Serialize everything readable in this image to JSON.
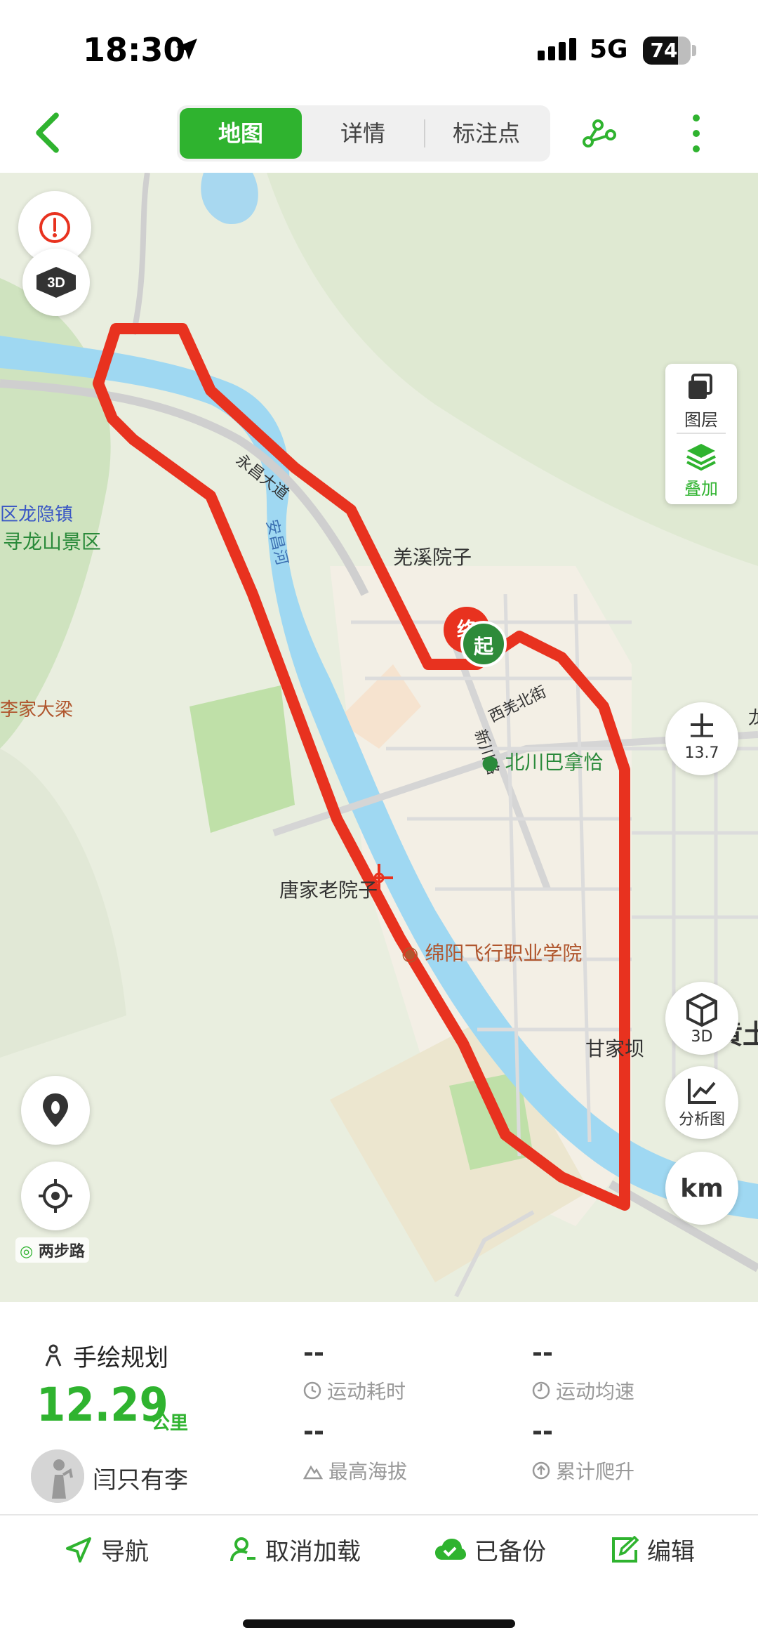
{
  "status": {
    "time": "18:30",
    "network": "5G",
    "battery": "74",
    "battery_level": 0.74
  },
  "header": {
    "tabs": [
      {
        "label": "地图",
        "active": true
      },
      {
        "label": "详情",
        "active": false
      },
      {
        "label": "标注点",
        "active": false
      }
    ],
    "accent_color": "#2fb32f"
  },
  "map": {
    "labels": {
      "town1": "区龙隐镇",
      "scenic": "寻龙山景区",
      "village1": "羌溪院子",
      "river": "安昌河",
      "road1": "永昌大道",
      "road2": "西羌北街",
      "road3": "新川路",
      "poi1": "北川巴拿恰",
      "village2": "唐家老院子",
      "poi2": "绵阳飞行职业学院",
      "village3": "李家大梁",
      "city": "黄土",
      "bottom": "甘家坝",
      "edge_char": "龙"
    },
    "markers": {
      "end": "终",
      "start": "起"
    },
    "controls": {
      "layers_label": "图层",
      "overlay_label": "叠加",
      "zoom_level": "13.7",
      "three_d_label": "3D",
      "analysis_label": "分析图",
      "unit_label": "km",
      "brand": "两步路"
    },
    "route_color": "#e8321f"
  },
  "info": {
    "plan_type": "手绘规划",
    "distance": "12.29",
    "distance_unit": "公里",
    "author": "闫只有李",
    "stats": [
      {
        "value": "--",
        "label": "运动耗时"
      },
      {
        "value": "--",
        "label": "运动均速"
      },
      {
        "value": "--",
        "label": "最高海拔"
      },
      {
        "value": "--",
        "label": "累计爬升"
      }
    ]
  },
  "actions": {
    "navigate": "导航",
    "unload": "取消加载",
    "backed_up": "已备份",
    "edit": "编辑"
  }
}
